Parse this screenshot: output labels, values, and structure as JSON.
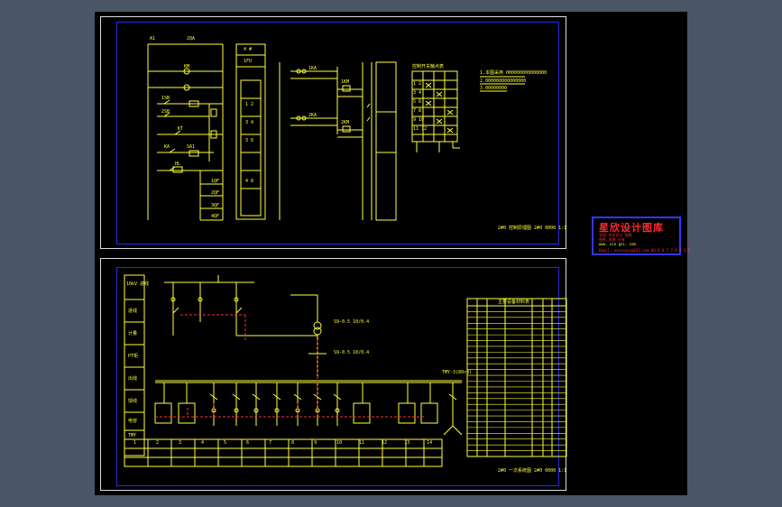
{
  "colors": {
    "viewport_bg": "#4a5566",
    "canvas_bg": "#000000",
    "sheet_border": "#dcdcdc",
    "frame_blue": "#2a2ae0",
    "line_yellow": "#ffff3a",
    "line_red": "#ff3030",
    "logo_red": "#ff2a2a"
  },
  "sheet1": {
    "title_block_text": "2#0 控制原理图 2#0 0000 1:1",
    "panel_labels": [
      "4 #",
      "1FU",
      "1 2",
      "3 4",
      "3 6",
      "4 8"
    ],
    "left_labels": [
      "A1",
      "2QA",
      "KM",
      "1SB",
      "2SB",
      "KT",
      "KA",
      "SA1",
      "HL",
      "1QF",
      "2QF",
      "3QF",
      "4QF"
    ],
    "table_header": "控制开关触点表",
    "table_rows": [
      "1 2",
      "3 4",
      "5 6",
      "7 8",
      "9 10",
      "11 12"
    ],
    "notes": [
      "1.本图采用 000000000000000",
      "2.000000000000000",
      "3.00000000"
    ],
    "relay_labels": [
      "1KA",
      "2KA",
      "1KM",
      "2KM"
    ]
  },
  "sheet2": {
    "title_block_text": "2#0 一次系统图 2#0 0000 1:1",
    "left_column_labels": [
      "10kV 进线",
      "进线",
      "计量",
      "PT柜",
      "出线",
      "馈线",
      "电容",
      "TMY"
    ],
    "transformer_labels": [
      "S9-0.5 10/0.4",
      "S9-0.5 10/0.4"
    ],
    "bus_label": "TMY-3(80×8)",
    "feeder_numbers": [
      "1",
      "2",
      "3",
      "4",
      "5",
      "6",
      "7",
      "8",
      "9",
      "10",
      "11",
      "12",
      "13",
      "14"
    ],
    "device_list_title": "主要设备材料表",
    "device_list_row_count": 26
  },
  "logo": {
    "title": "星欣设计图库",
    "line1": "学校 毕业设计 图纸",
    "line2": "图纸 资源 分享",
    "line3": "www. xin gsi. com",
    "line4": "Email: xxxxxxxx@163.com QQ:8 8 7 2 9 9 3 6"
  }
}
